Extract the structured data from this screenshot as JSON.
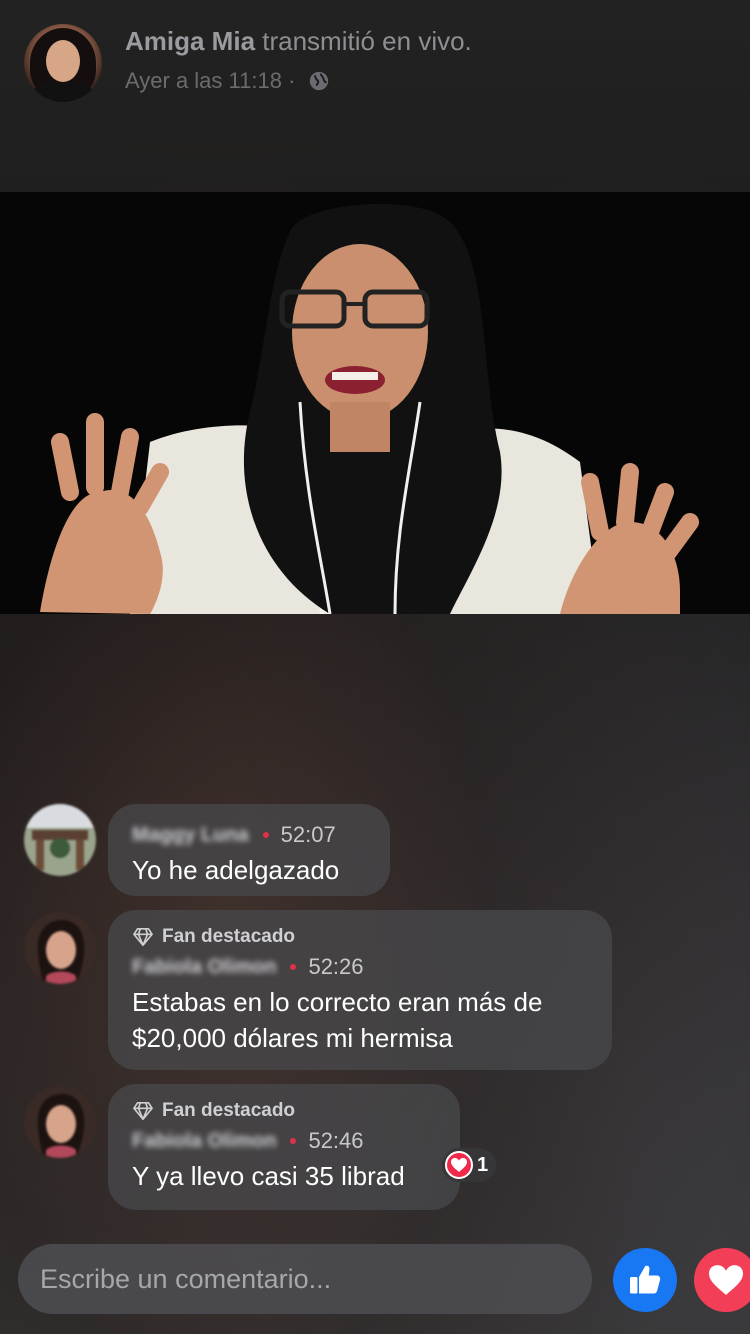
{
  "header": {
    "name": "Amiga Mia",
    "action": " transmitió en vivo.",
    "timestamp": "Ayer a las 11:18 ·"
  },
  "comments": [
    {
      "author": "Maggy Luna",
      "time": "52:07",
      "text": "Yo he adelgazado"
    },
    {
      "badge": "Fan destacado",
      "author": "Fabiola Olimon",
      "time": "52:26",
      "text": "Estabas en lo correcto eran más de $20,000 dólares mi hermisa"
    },
    {
      "badge": "Fan destacado",
      "author": "Fabiola Olimon",
      "time": "52:46",
      "text": "Y ya llevo casi 35 librad",
      "reaction_count": "1"
    }
  ],
  "composer": {
    "placeholder": "Escribe un comentario..."
  },
  "colors": {
    "like": "#1877f2",
    "love": "#f33e58",
    "dot": "#e0304a"
  }
}
